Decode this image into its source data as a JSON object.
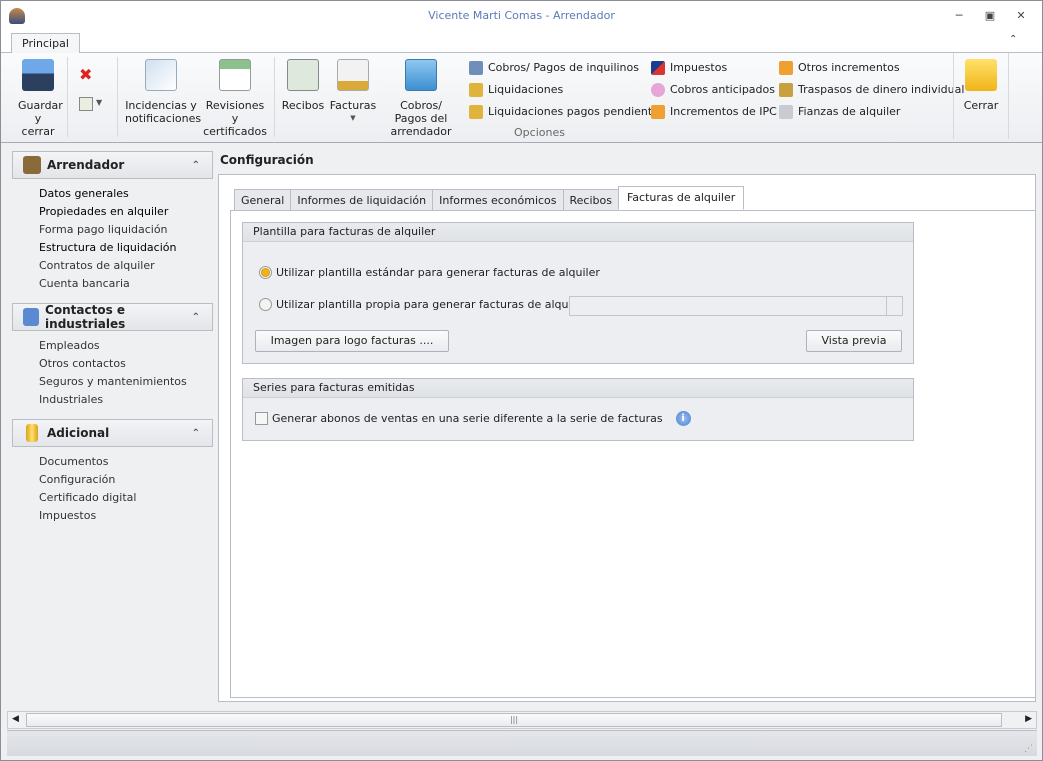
{
  "window": {
    "title": "Vicente Marti Comas - Arrendador",
    "minimize_icon": "minimize-icon",
    "restore_icon": "restore-icon",
    "close_icon": "close-icon"
  },
  "ribbon": {
    "tab": "Principal",
    "save": "Guardar y cerrar",
    "incidencias": "Incidencias y notificaciones",
    "revisiones": "Revisiones y certificados",
    "recibos": "Recibos",
    "facturas": "Facturas",
    "cobros_arrendador": "Cobros/ Pagos del arrendador",
    "col1": [
      "Cobros/ Pagos de inquilinos",
      "Liquidaciones",
      "Liquidaciones pagos pendientes"
    ],
    "col2": [
      "Impuestos",
      "Cobros anticipados",
      "Incrementos de IPC"
    ],
    "col3": [
      "Otros incrementos",
      "Traspasos de dinero individual",
      "Fianzas de alquiler"
    ],
    "group_label": "Opciones",
    "close": "Cerrar"
  },
  "sidebar": {
    "sections": [
      {
        "title": "Arrendador",
        "items": [
          "Datos generales",
          "Propiedades en alquiler",
          "Forma pago liquidación",
          "Estructura de liquidación",
          "Contratos de alquiler",
          "Cuenta bancaria"
        ]
      },
      {
        "title": "Contactos e industriales",
        "items": [
          "Empleados",
          "Otros contactos",
          "Seguros y mantenimientos",
          "Industriales"
        ]
      },
      {
        "title": "Adicional",
        "items": [
          "Documentos",
          "Configuración",
          "Certificado digital",
          "Impuestos"
        ]
      }
    ]
  },
  "main": {
    "title": "Configuración",
    "tabs": [
      "General",
      "Informes de liquidación",
      "Informes económicos",
      "Recibos",
      "Facturas de alquiler"
    ],
    "active_tab": "Facturas de alquiler",
    "group1": {
      "title": "Plantilla para facturas de alquiler",
      "radio1": "Utilizar plantilla estándar para generar facturas de alquiler",
      "radio2": "Utilizar plantilla propia para generar facturas de alquiler",
      "selected": "radio1",
      "template_path": "",
      "logo_button": "Imagen para logo facturas ....",
      "preview_button": "Vista previa"
    },
    "group2": {
      "title": "Series para facturas emitidas",
      "checkbox": "Generar abonos de ventas en una serie diferente a la serie de facturas",
      "checked": false
    }
  },
  "colors": {
    "accent": "#5a7bb5",
    "radio_selected": "#f0b419"
  }
}
